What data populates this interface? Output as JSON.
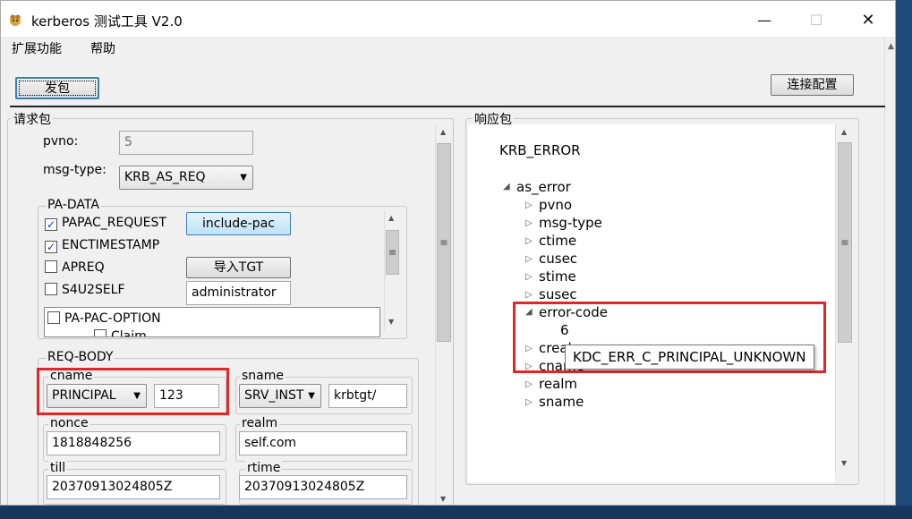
{
  "window": {
    "title": "kerberos 测试工具 V2.0",
    "minimize": "—",
    "maximize": "☐",
    "close": "✕"
  },
  "menu": [
    "扩展功能",
    "帮助"
  ],
  "toolbar": {
    "send_label": "发包",
    "connect_label": "连接配置"
  },
  "request": {
    "group_label": "请求包",
    "pvno_label": "pvno:",
    "pvno_value": "5",
    "msgtype_label": "msg-type:",
    "msgtype_value": "KRB_AS_REQ",
    "padata": {
      "label": "PA-DATA",
      "items": [
        {
          "label": "PAPAC_REQUEST",
          "checked": true
        },
        {
          "label": "ENCTIMESTAMP",
          "checked": true
        },
        {
          "label": "APREQ",
          "checked": false
        },
        {
          "label": "S4U2SELF",
          "checked": false
        }
      ],
      "include_pac_label": "include-pac",
      "import_tgt_label": "导入TGT",
      "s4u_user_value": "administrator",
      "pac_option_label": "PA-PAC-OPTION",
      "pac_option_child": "Claim"
    },
    "reqbody": {
      "label": "REQ-BODY",
      "cname_label": "cname",
      "cname_type": "PRINCIPAL",
      "cname_value": "123",
      "sname_label": "sname",
      "sname_type": "SRV_INST",
      "sname_value": "krbtgt/",
      "nonce_label": "nonce",
      "nonce_value": "1818848256",
      "realm_label": "realm",
      "realm_value": "self.com",
      "till_label": "till",
      "till_value": "20370913024805Z",
      "rtime_label": "rtime",
      "rtime_value": "20370913024805Z"
    }
  },
  "response": {
    "group_label": "响应包",
    "title": "KRB_ERROR",
    "root": "as_error",
    "children": [
      "pvno",
      "msg-type",
      "ctime",
      "cusec",
      "stime",
      "susec"
    ],
    "error_code_label": "error-code",
    "error_code_value": "6",
    "after_children": [
      "crealm",
      "cname",
      "realm",
      "sname"
    ],
    "tooltip": "KDC_ERR_C_PRINCIPAL_UNKNOWN"
  },
  "colors": {
    "highlight": "#e0282a",
    "accent": "#3c7fb1"
  }
}
